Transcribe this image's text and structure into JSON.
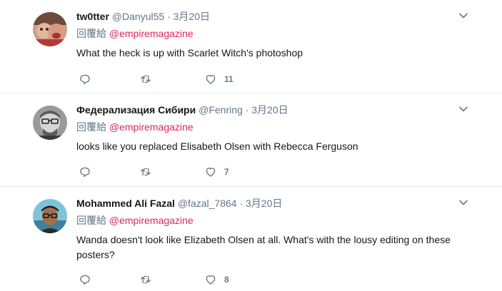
{
  "tweets": [
    {
      "display_name": "tw0tter",
      "handle": "@Danyul55",
      "dot": "·",
      "date": "3月20日",
      "reply_prefix": "回覆給",
      "mention": "@empiremagazine",
      "text": "What the heck is up with Scarlet Witch's photoshop",
      "reply_count": "",
      "retweet_count": "",
      "like_count": "11"
    },
    {
      "display_name": "Федерализация Сибири",
      "handle": "@Fenring",
      "dot": "·",
      "date": "3月20日",
      "reply_prefix": "回覆給",
      "mention": "@empiremagazine",
      "text": "looks like you replaced Elisabeth Olsen with Rebecca Ferguson",
      "reply_count": "",
      "retweet_count": "",
      "like_count": "7"
    },
    {
      "display_name": "Mohammed Ali Fazal",
      "handle": "@fazal_7864",
      "dot": "·",
      "date": "3月20日",
      "reply_prefix": "回覆給",
      "mention": "@empiremagazine",
      "text": "Wanda doesn't look like Elizabeth Olsen at all. What's with the lousy editing on these posters?",
      "reply_count": "",
      "retweet_count": "",
      "like_count": "8"
    }
  ],
  "icons": {
    "reply": "reply-icon",
    "retweet": "retweet-icon",
    "like": "heart-icon",
    "more": "chevron-down-icon"
  },
  "colors": {
    "icon": "#657786",
    "mention": "#e0245e",
    "divider": "#e6ecf0"
  }
}
